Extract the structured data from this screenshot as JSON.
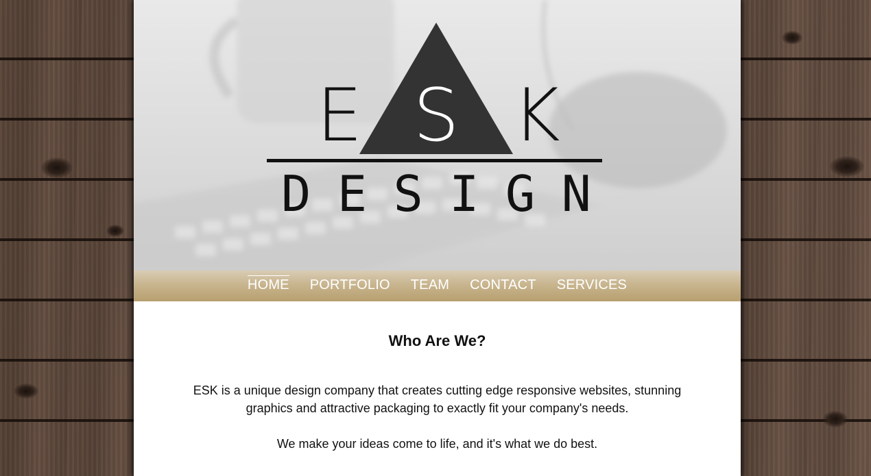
{
  "brand": {
    "logo_letter_left": "E",
    "logo_letter_center": "S",
    "logo_letter_right": "K",
    "logo_subtitle": "DESIGN"
  },
  "nav": {
    "items": [
      {
        "label": "HOME",
        "active": true
      },
      {
        "label": "PORTFOLIO",
        "active": false
      },
      {
        "label": "TEAM",
        "active": false
      },
      {
        "label": "CONTACT",
        "active": false
      },
      {
        "label": "SERVICES",
        "active": false
      }
    ]
  },
  "main": {
    "heading": "Who Are We?",
    "paragraph_1": "ESK is a unique design company that creates cutting edge responsive websites, stunning graphics and attractive packaging to exactly fit your company's needs.",
    "paragraph_2": "We make your ideas come to life, and it's what we do best."
  },
  "colors": {
    "nav_gold": "#c8b58f",
    "logo_dark": "#333333",
    "page_background": "#ffffff",
    "wood": "#5b4639"
  },
  "icons": {
    "logo": "triangle-logo-icon"
  }
}
